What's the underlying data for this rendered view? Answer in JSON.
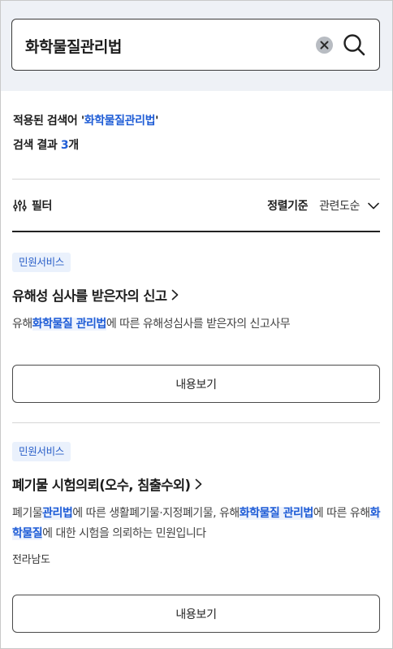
{
  "search": {
    "value": "화학물질관리법"
  },
  "summary": {
    "applied_prefix": "적용된 검색어 '",
    "applied_term": "화학물질관리법",
    "applied_suffix": "'",
    "count_prefix": "검색 결과 ",
    "count_value": "3",
    "count_suffix": "개"
  },
  "toolbar": {
    "filter_label": "필터",
    "sort_label": "정렬기준",
    "sort_value": "관련도순"
  },
  "results": [
    {
      "badge": "민원서비스",
      "title": "유해성 심사를 받은자의 신고",
      "desc": [
        {
          "text": "유해",
          "hl": false
        },
        {
          "text": "화학물질 관리법",
          "hl": true
        },
        {
          "text": "에 따른 유해성심사를 받은자의 신고사무",
          "hl": false
        }
      ],
      "region": "",
      "button": "내용보기"
    },
    {
      "badge": "민원서비스",
      "title": "폐기물 시험의뢰(오수, 침출수외)",
      "desc": [
        {
          "text": "폐기물",
          "hl": false
        },
        {
          "text": "관리법",
          "hl": true
        },
        {
          "text": "에 따른 생활폐기물·지정폐기물, 유해",
          "hl": false
        },
        {
          "text": "화학물질 관리법",
          "hl": true
        },
        {
          "text": "에 따른 유해",
          "hl": false
        },
        {
          "text": "화학물질",
          "hl": true
        },
        {
          "text": "에 대한 시험을 의뢰하는 민원입니다",
          "hl": false
        }
      ],
      "region": "전라남도",
      "button": "내용보기"
    }
  ],
  "colors": {
    "accent": "#1e5cd6",
    "search_bg": "#eef1f6",
    "badge_bg": "#eaf1fc",
    "highlight_bg": "#eef3fd"
  },
  "icons": {
    "clear": "close-circle-icon",
    "search": "search-icon",
    "filter": "sliders-icon",
    "sort": "chevron-down-icon",
    "title": "chevron-right-icon"
  }
}
